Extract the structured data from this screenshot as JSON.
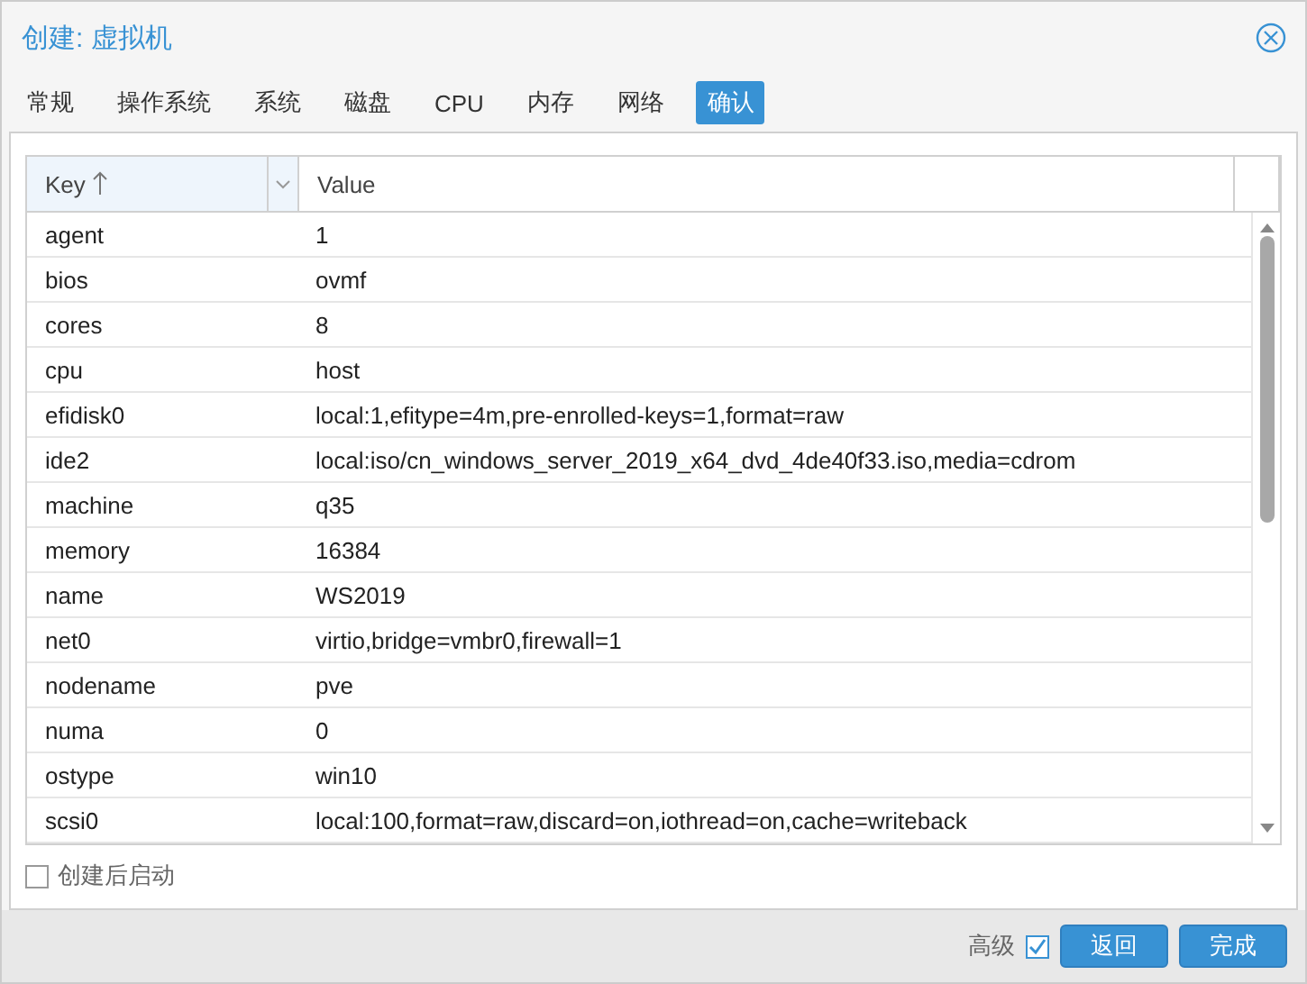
{
  "window": {
    "title": "创建: 虚拟机"
  },
  "tabs": [
    {
      "label": "常规",
      "selected": false
    },
    {
      "label": "操作系统",
      "selected": false
    },
    {
      "label": "系统",
      "selected": false
    },
    {
      "label": "磁盘",
      "selected": false
    },
    {
      "label": "CPU",
      "selected": false
    },
    {
      "label": "内存",
      "selected": false
    },
    {
      "label": "网络",
      "selected": false
    },
    {
      "label": "确认",
      "selected": true
    }
  ],
  "table": {
    "columns": [
      {
        "label": "Key",
        "sorted": true
      },
      {
        "label": "Value",
        "sorted": false
      }
    ],
    "rows": [
      {
        "key": "agent",
        "value": "1"
      },
      {
        "key": "bios",
        "value": "ovmf"
      },
      {
        "key": "cores",
        "value": "8"
      },
      {
        "key": "cpu",
        "value": "host"
      },
      {
        "key": "efidisk0",
        "value": "local:1,efitype=4m,pre-enrolled-keys=1,format=raw"
      },
      {
        "key": "ide2",
        "value": "local:iso/cn_windows_server_2019_x64_dvd_4de40f33.iso,media=cdrom"
      },
      {
        "key": "machine",
        "value": "q35"
      },
      {
        "key": "memory",
        "value": "16384"
      },
      {
        "key": "name",
        "value": "WS2019"
      },
      {
        "key": "net0",
        "value": "virtio,bridge=vmbr0,firewall=1"
      },
      {
        "key": "nodename",
        "value": "pve"
      },
      {
        "key": "numa",
        "value": "0"
      },
      {
        "key": "ostype",
        "value": "win10"
      },
      {
        "key": "scsi0",
        "value": "local:100,format=raw,discard=on,iothread=on,cache=writeback"
      }
    ]
  },
  "start_after_create": {
    "label": "创建后启动",
    "checked": false
  },
  "footer": {
    "advanced": {
      "label": "高级",
      "checked": true
    },
    "buttons": [
      "返回",
      "完成"
    ]
  }
}
